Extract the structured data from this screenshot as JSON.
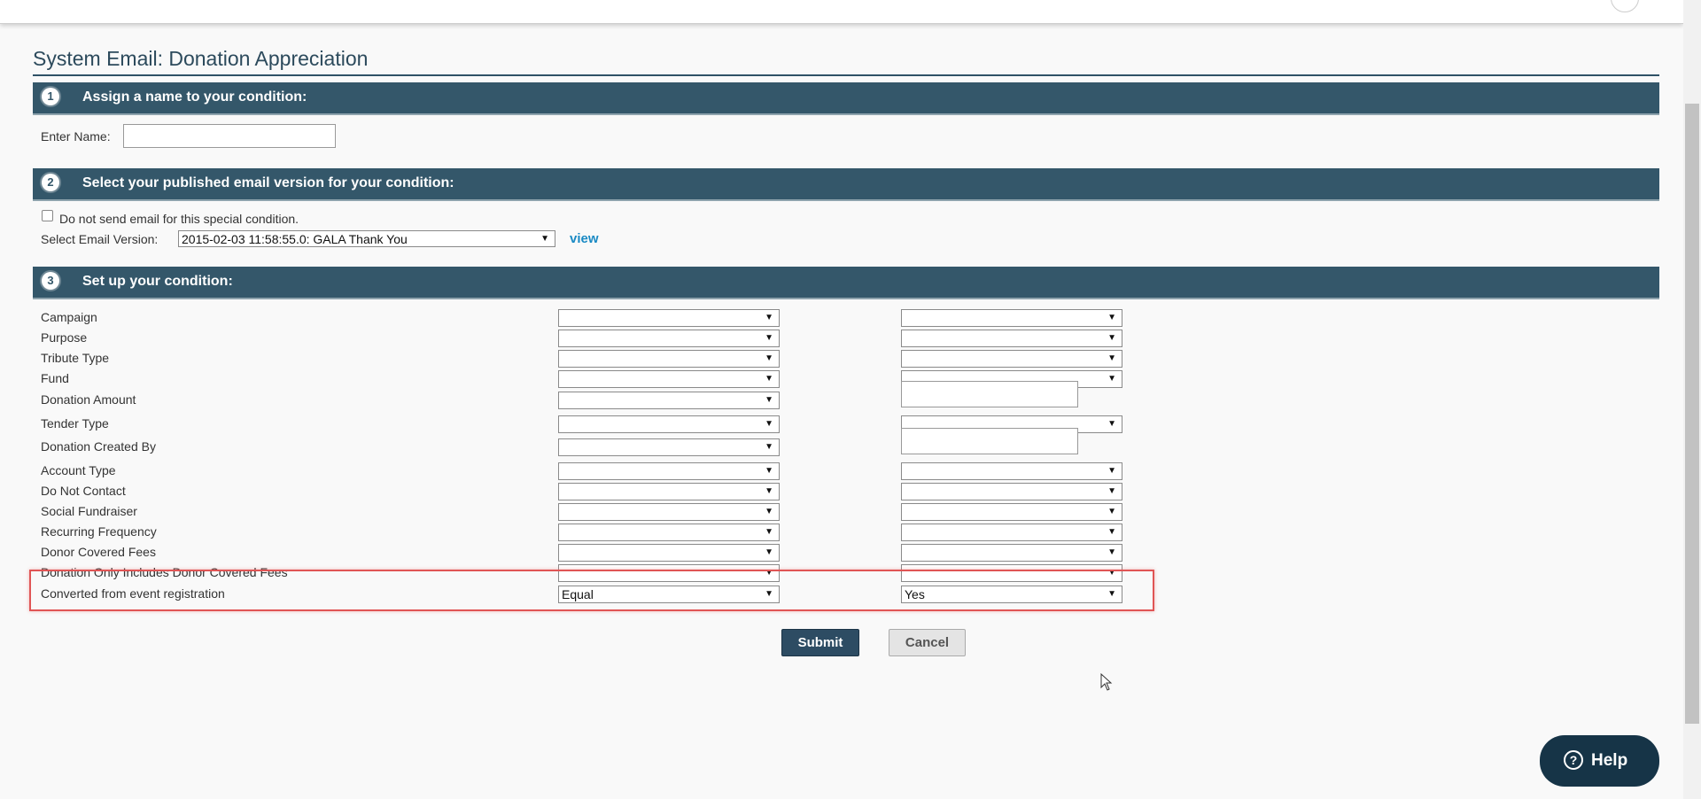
{
  "page_title": "System Email: Donation Appreciation",
  "sections": [
    {
      "step": "1",
      "title": "Assign a name to your condition:"
    },
    {
      "step": "2",
      "title": "Select your published email version for your condition:"
    },
    {
      "step": "3",
      "title": "Set up your condition:"
    }
  ],
  "name_section": {
    "label": "Enter Name:",
    "value": ""
  },
  "email_section": {
    "checkbox_label": "Do not send email for this special condition.",
    "version_label": "Select Email Version:",
    "version_value": "2015-02-03 11:58:55.0: GALA Thank You",
    "view_link": "view"
  },
  "conditions": [
    {
      "label": "Campaign",
      "operator": "",
      "value": "",
      "value_type": "select"
    },
    {
      "label": "Purpose",
      "operator": "",
      "value": "",
      "value_type": "select"
    },
    {
      "label": "Tribute Type",
      "operator": "",
      "value": "",
      "value_type": "select"
    },
    {
      "label": "Fund",
      "operator": "",
      "value": "",
      "value_type": "select"
    },
    {
      "label": "Donation Amount",
      "operator": "",
      "value": "",
      "value_type": "text"
    },
    {
      "label": "Tender Type",
      "operator": "",
      "value": "",
      "value_type": "select"
    },
    {
      "label": "Donation Created By",
      "operator": "",
      "value": "",
      "value_type": "text"
    },
    {
      "label": "Account Type",
      "operator": "",
      "value": "",
      "value_type": "select"
    },
    {
      "label": "Do Not Contact",
      "operator": "",
      "value": "",
      "value_type": "select"
    },
    {
      "label": "Social Fundraiser",
      "operator": "",
      "value": "",
      "value_type": "select"
    },
    {
      "label": "Recurring Frequency",
      "operator": "",
      "value": "",
      "value_type": "select"
    },
    {
      "label": "Donor Covered Fees",
      "operator": "",
      "value": "",
      "value_type": "select"
    },
    {
      "label": "Donation Only Includes Donor Covered Fees",
      "operator": "",
      "value": "",
      "value_type": "select"
    },
    {
      "label": "Converted from event registration",
      "operator": "Equal",
      "value": "Yes",
      "value_type": "select"
    }
  ],
  "buttons": {
    "submit": "Submit",
    "cancel": "Cancel"
  },
  "help": {
    "icon": "?",
    "label": "Help"
  },
  "colors": {
    "header_bg": "#34576a",
    "accent_link": "#1a8ac4",
    "highlight": "#e05555",
    "help_bg": "#163447"
  }
}
